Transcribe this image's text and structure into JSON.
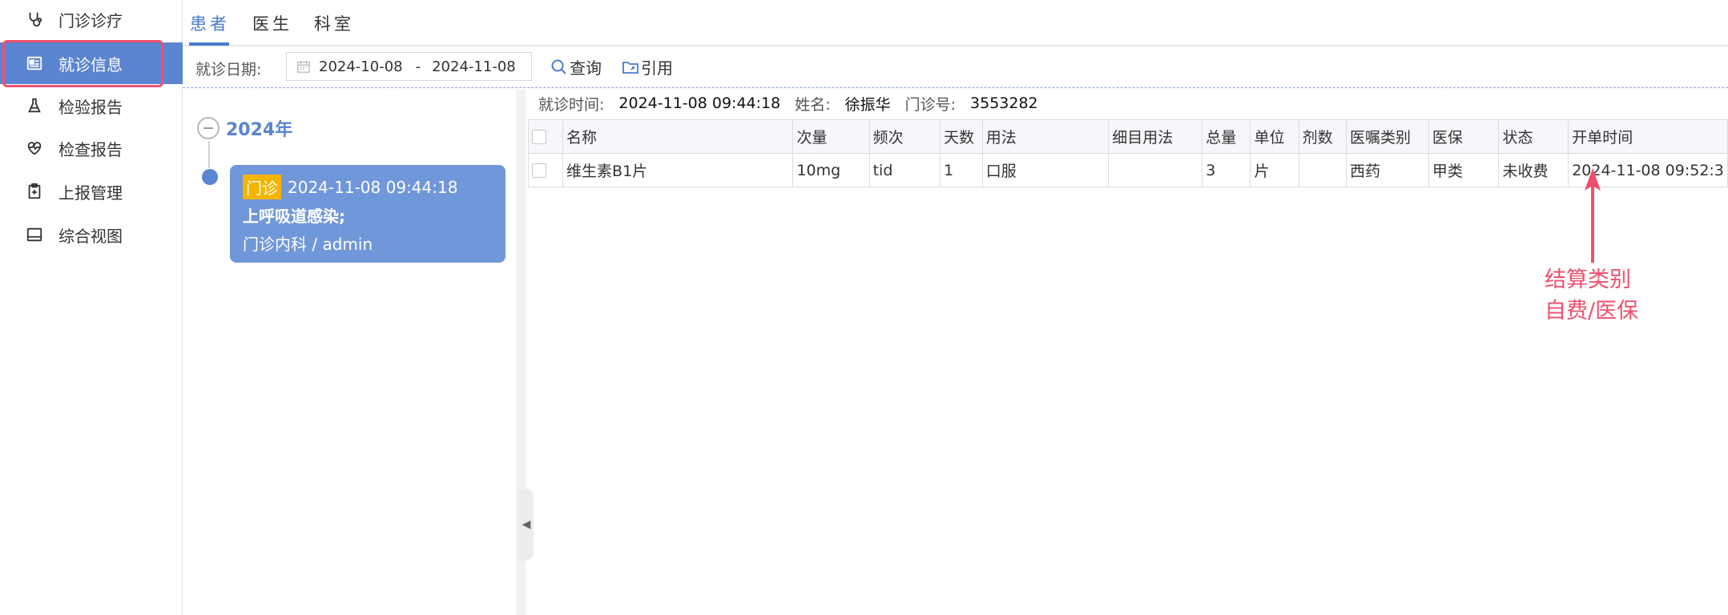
{
  "sidebar": {
    "items": [
      {
        "label": "门诊诊疗",
        "icon": "stethoscope-icon"
      },
      {
        "label": "就诊信息",
        "icon": "id-card-icon"
      },
      {
        "label": "检验报告",
        "icon": "flask-icon"
      },
      {
        "label": "检查报告",
        "icon": "heartbeat-icon"
      },
      {
        "label": "上报管理",
        "icon": "clipboard-plus-icon"
      },
      {
        "label": "综合视图",
        "icon": "monitor-icon"
      }
    ],
    "active_index": 1
  },
  "tabs": [
    {
      "label": "患者",
      "active": true
    },
    {
      "label": "医生",
      "active": false
    },
    {
      "label": "科室",
      "active": false
    }
  ],
  "filter": {
    "date_label": "就诊日期:",
    "date_from": "2024-10-08",
    "date_sep": "-",
    "date_to": "2024-11-08",
    "query_label": "查询",
    "cite_label": "引用"
  },
  "timeline": {
    "year": "2024年",
    "visit": {
      "badge": "门诊",
      "datetime": "2024-11-08 09:44:18",
      "diagnosis": "上呼吸道感染;",
      "dept_user": "门诊内科 / admin"
    }
  },
  "detail": {
    "visit_time_label": "就诊时间:",
    "visit_time": "2024-11-08 09:44:18",
    "name_label": "姓名:",
    "name": "徐振华",
    "clinic_no_label": "门诊号:",
    "clinic_no": "3553282",
    "columns": [
      "名称",
      "次量",
      "频次",
      "天数",
      "用法",
      "细目用法",
      "总量",
      "单位",
      "剂数",
      "医嘱类别",
      "医保",
      "状态",
      "开单时间"
    ],
    "rows": [
      [
        "维生素B1片",
        "10mg",
        "tid",
        "1",
        "口服",
        "",
        "3",
        "片",
        "",
        "西药",
        "甲类",
        "未收费",
        "2024-11-08 09:52:3"
      ]
    ]
  },
  "annotation": {
    "line1": "结算类别",
    "line2": "自费/医保",
    "color": "#f0506e"
  },
  "colors": {
    "accent": "#5b84d1",
    "card": "#7097da",
    "badge": "#f5b400",
    "highlight": "#f0506e"
  }
}
